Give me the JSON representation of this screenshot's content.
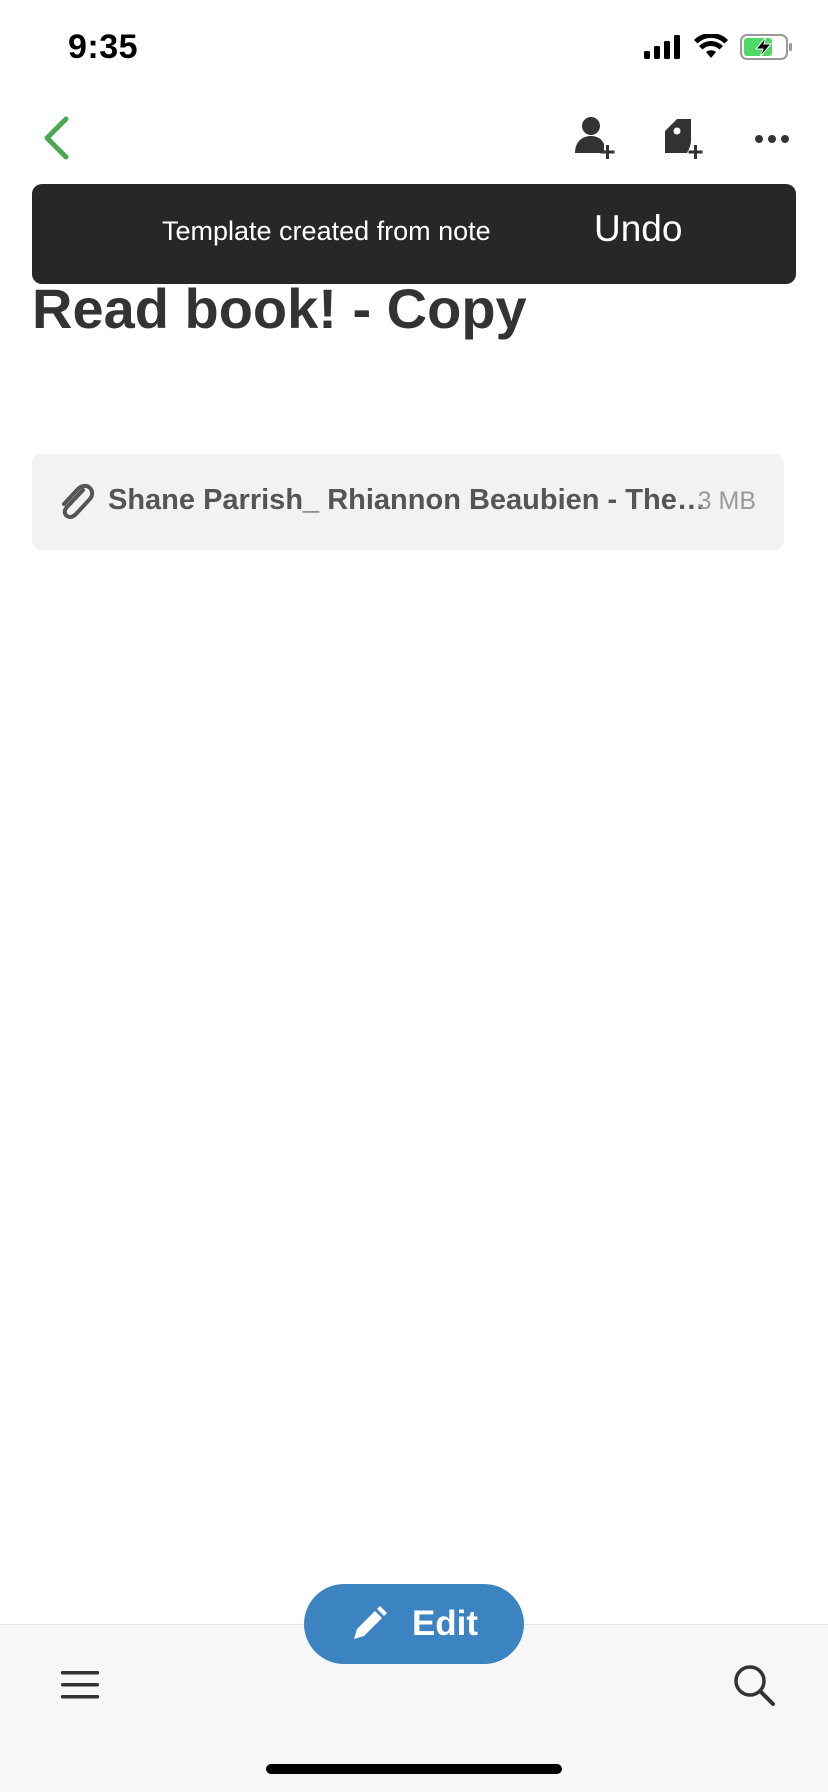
{
  "status_bar": {
    "time": "9:35",
    "icons": [
      "signal-icon",
      "wifi-icon",
      "battery-charging-icon"
    ]
  },
  "nav": {
    "back_icon": "chevron-left-icon",
    "actions": [
      "share-user-icon",
      "add-tag-icon",
      "more-icon"
    ]
  },
  "toast": {
    "message": "Template created from note",
    "action_label": "Undo"
  },
  "note": {
    "title": "Read book! - Copy"
  },
  "attachment": {
    "icon": "paperclip-icon",
    "name": "Shane Parrish_ Rhiannon Beaubien - The Great Mental Models",
    "size": "3 MB"
  },
  "bottom_bar": {
    "menu_icon": "hamburger-menu-icon",
    "search_icon": "search-icon",
    "edit_label": "Edit",
    "edit_icon": "pencil-icon"
  },
  "colors": {
    "accent_green": "#4aa84f",
    "edit_blue": "#3c83c2",
    "toast_bg": "#272727"
  }
}
